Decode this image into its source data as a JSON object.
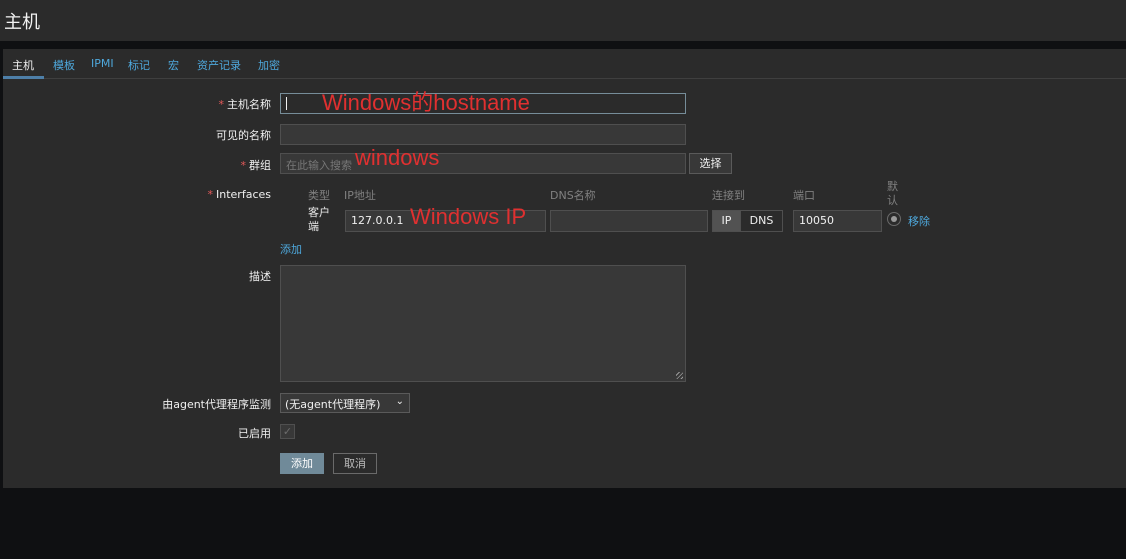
{
  "page": {
    "title": "主机"
  },
  "tabs": [
    {
      "label": "主机"
    },
    {
      "label": "模板"
    },
    {
      "label": "IPMI"
    },
    {
      "label": "标记"
    },
    {
      "label": "宏"
    },
    {
      "label": "资产记录"
    },
    {
      "label": "加密"
    }
  ],
  "form": {
    "hostname_label": "主机名称",
    "visible_name_label": "可见的名称",
    "groups_label": "群组",
    "groups_placeholder": "在此输入搜索",
    "select_button": "选择",
    "interfaces_label": "Interfaces",
    "interfaces": {
      "headers": {
        "type": "类型",
        "ip": "IP地址",
        "dns": "DNS名称",
        "connect": "连接到",
        "port": "端口",
        "default": "默认"
      },
      "row": {
        "type": "客户端",
        "ip": "127.0.0.1",
        "dns": "",
        "connect_ip": "IP",
        "connect_dns": "DNS",
        "port": "10050",
        "remove": "移除"
      },
      "add_link": "添加"
    },
    "description_label": "描述",
    "proxy_label": "由agent代理程序监测",
    "proxy_value": "(无agent代理程序)",
    "enabled_label": "已启用",
    "enabled": true,
    "add_button": "添加",
    "cancel_button": "取消"
  },
  "annotations": {
    "hostname": "Windows的hostname",
    "groups": "windows",
    "ip": "Windows IP"
  },
  "colors": {
    "accent": "#4ea8dc",
    "required": "#e45959",
    "annotation": "#e03030",
    "primary_button": "#708a99"
  }
}
